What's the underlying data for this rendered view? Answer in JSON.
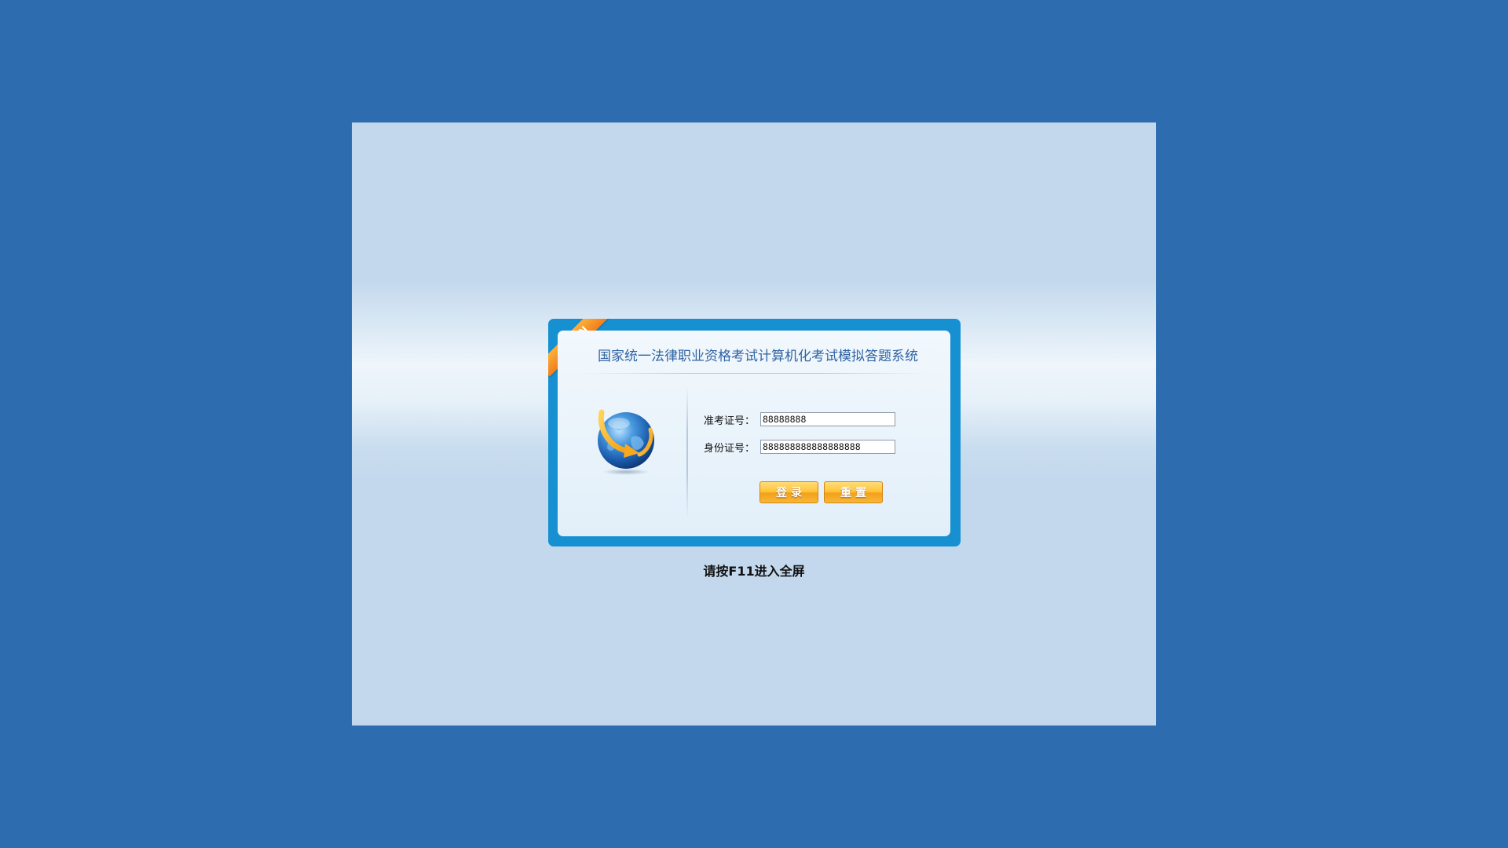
{
  "login": {
    "ribbon_text": "LOGIN",
    "title": "国家统一法律职业资格考试计算机化考试模拟答题系统",
    "fields": {
      "exam_number": {
        "label": "准考证号：",
        "value": "88888888"
      },
      "id_number": {
        "label": "身份证号：",
        "value": "888888888888888888"
      }
    },
    "buttons": {
      "login": "登录",
      "reset": "重置"
    },
    "logo_icon": "globe-arrow-icon"
  },
  "hint": "请按F11进入全屏",
  "colors": {
    "page_background": "#2c6caf",
    "frame_border": "#1790d2",
    "title_text": "#2f63a3",
    "button_orange": "#f7a81e",
    "ribbon_orange": "#f6901f"
  }
}
